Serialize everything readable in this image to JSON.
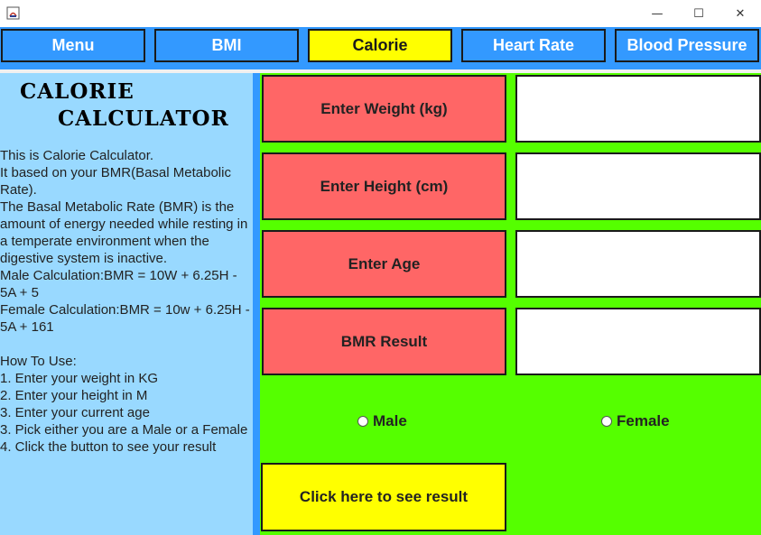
{
  "window": {
    "minimize": "—",
    "maximize": "☐",
    "close": "✕"
  },
  "nav": {
    "menu": "Menu",
    "bmi": "BMI",
    "calorie": "Calorie",
    "heart_rate": "Heart Rate",
    "blood_pressure": "Blood Pressure",
    "active_tab": "Calorie"
  },
  "sidebar": {
    "title_line1": "CALORIE",
    "title_line2": "CALCULATOR",
    "description": "This is Calorie Calculator.\nIt based on your BMR(Basal Metabolic Rate).\nThe Basal Metabolic Rate (BMR) is the amount of energy needed while resting in a temperate environment when the digestive system is inactive.\nMale Calculation:BMR = 10W + 6.25H - 5A + 5\nFemale Calculation:BMR = 10w + 6.25H - 5A + 161\n\nHow To Use:\n1. Enter your weight in KG\n2. Enter your height in M\n3. Enter your current age\n3. Pick either you are a Male or a Female\n4. Click the button to see your result"
  },
  "form": {
    "weight_label": "Enter Weight (kg)",
    "weight_value": "",
    "height_label": "Enter Height (cm)",
    "height_value": "",
    "age_label": "Enter Age",
    "age_value": "",
    "result_label": "BMR Result",
    "result_value": "",
    "male_label": "Male",
    "female_label": "Female",
    "submit_label": "Click here to see result"
  },
  "colors": {
    "nav_blue": "#3399ff",
    "active_yellow": "#ffff00",
    "panel_green": "#55ff00",
    "label_red": "#ff6666",
    "sidebar_light_blue": "#99d9ff"
  }
}
